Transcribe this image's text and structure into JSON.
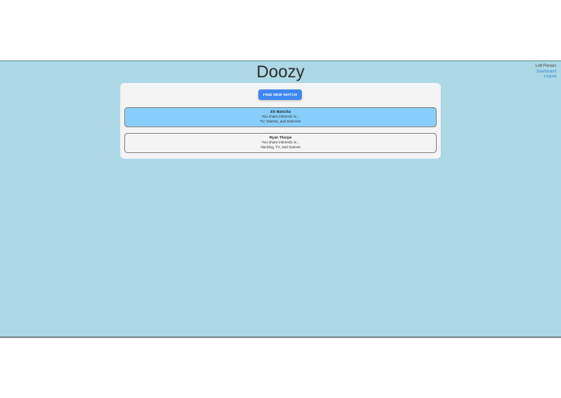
{
  "app": {
    "title": "Doozy"
  },
  "user_menu": {
    "name": "Left Person",
    "links": [
      "Dashboard",
      "Logout"
    ]
  },
  "actions": {
    "find_match_label": "FIND NEW MATCH"
  },
  "matches": [
    {
      "name": "Ziv Batscha",
      "intro": "You share interests in...",
      "interests": "TV, Games, and Exercise",
      "selected": true
    },
    {
      "name": "Ryan Thorpe",
      "intro": "You share interests in...",
      "interests": "Hacking, TV, and Games",
      "selected": false
    }
  ],
  "colors": {
    "background": "#add8e6",
    "panel": "#f4f4f4",
    "button": "#3e87f0",
    "selected_card": "#87cefa",
    "link": "#3a86d1"
  }
}
